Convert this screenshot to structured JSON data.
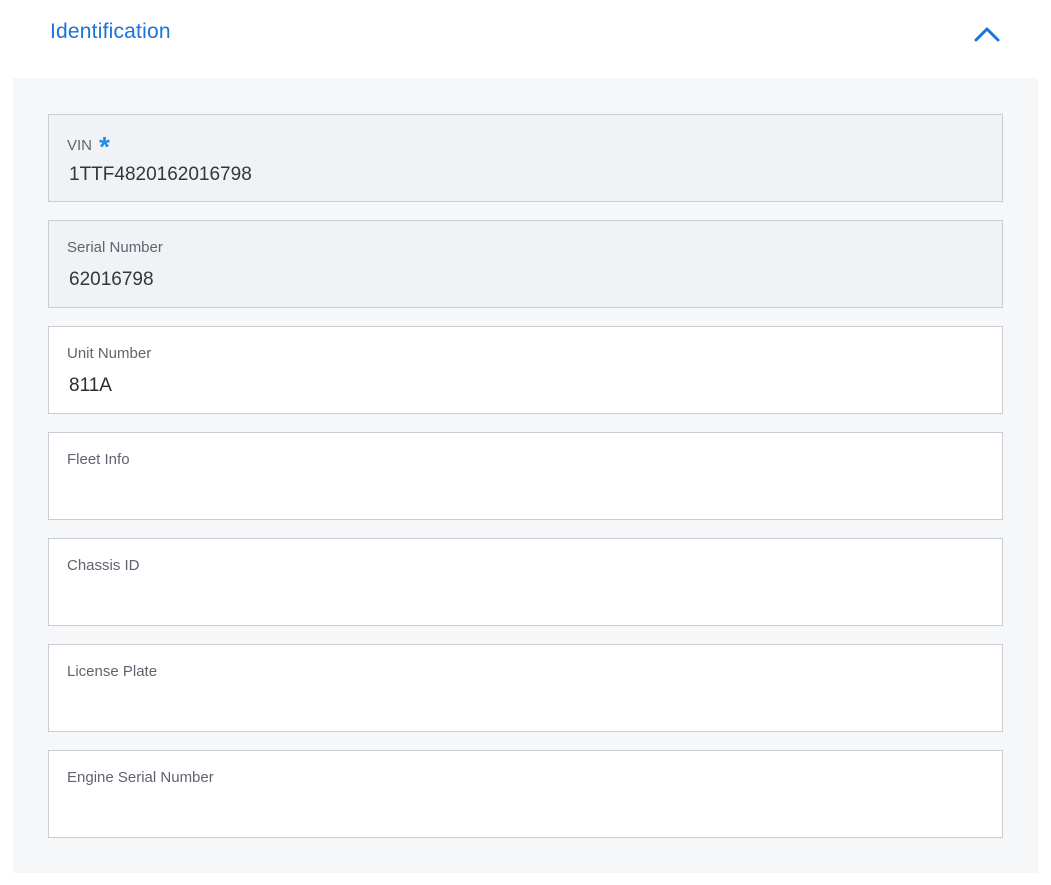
{
  "section": {
    "title": "Identification",
    "toggle_icon": "chevron-up-icon"
  },
  "colors": {
    "accent": "#1a73d9",
    "required": "#1a8fe8",
    "panel_bg": "#f6f7f9",
    "readonly_bg": "#f1f2f5"
  },
  "fields": [
    {
      "label": "VIN",
      "required": true,
      "value": "1TTF4820162016798",
      "readonly": true
    },
    {
      "label": "Serial Number",
      "value": "62016798",
      "readonly": true
    },
    {
      "label": "Unit Number",
      "value": "811A",
      "readonly": false
    },
    {
      "label": "Fleet Info",
      "value": "",
      "readonly": false
    },
    {
      "label": "Chassis ID",
      "value": "",
      "readonly": false
    },
    {
      "label": "License Plate",
      "value": "",
      "readonly": false
    },
    {
      "label": "Engine Serial Number",
      "value": "",
      "readonly": false
    }
  ]
}
